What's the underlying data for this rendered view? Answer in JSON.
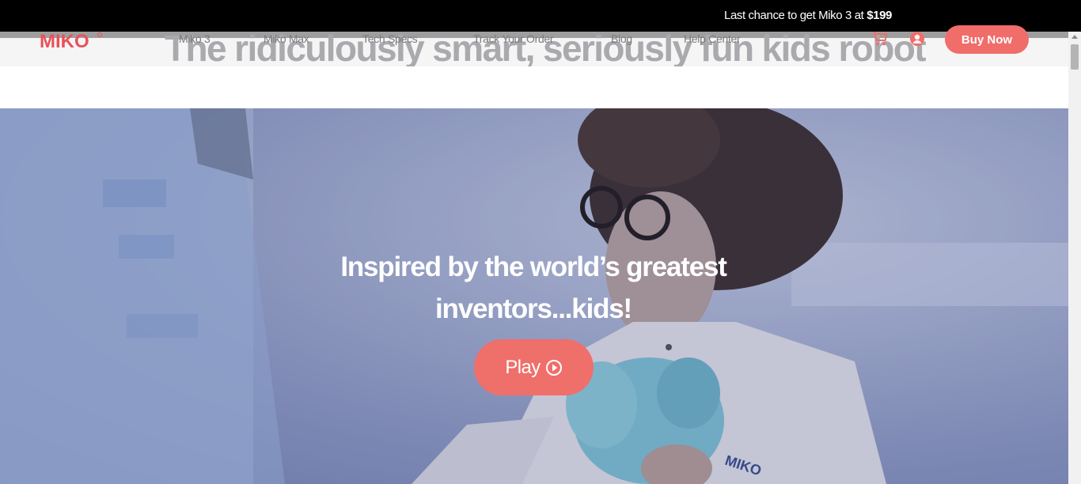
{
  "announcement": {
    "text": "Last chance to get Miko 3 at ",
    "price": "$199"
  },
  "header": {
    "logo_text": "MIKO",
    "background_headline": "The ridiculously smart, seriously fun kids robot",
    "nav": [
      {
        "label": "Miko 3"
      },
      {
        "label": "Miko Max"
      },
      {
        "label": "Tech Specs"
      },
      {
        "label": "Track Your Order"
      },
      {
        "label": "Blog"
      },
      {
        "label": "Help Center"
      }
    ],
    "cart_icon": "cart-icon",
    "account_icon": "user-icon",
    "buy_label": "Buy Now"
  },
  "hero": {
    "title_line1": "Inspired by the world’s greatest",
    "title_line2": "inventors...kids!",
    "play_label": "Play",
    "play_icon": "play-circle-icon"
  },
  "colors": {
    "accent": "#f06d6a",
    "announcement_bg": "#000000",
    "nav_text": "#7a7a7a"
  }
}
